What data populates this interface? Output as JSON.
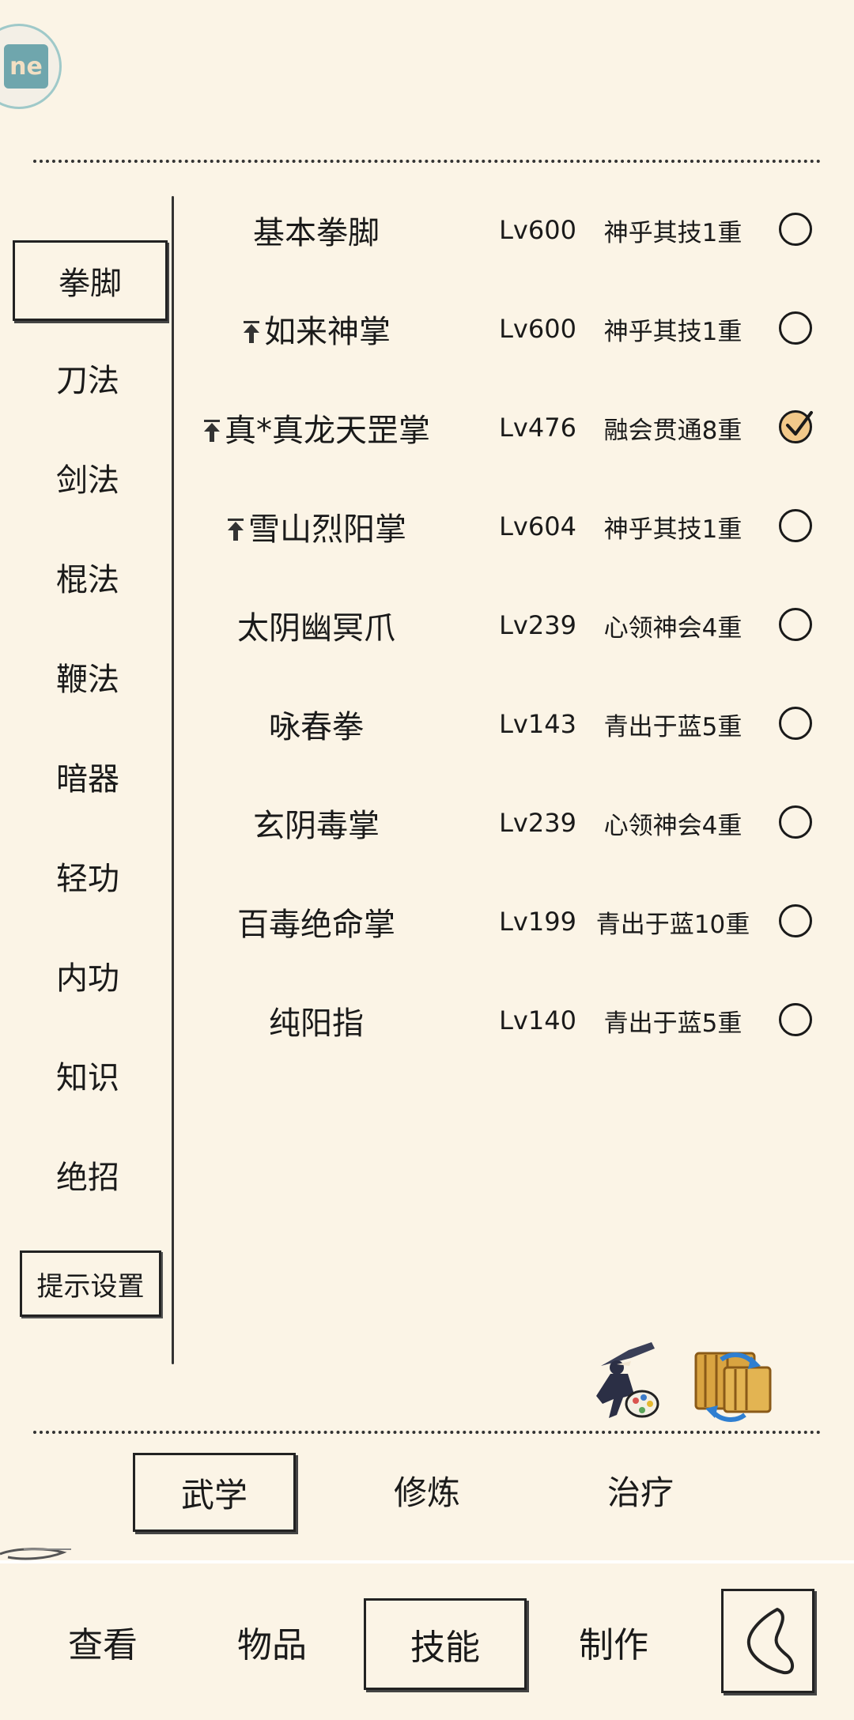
{
  "logo": {
    "text": "ne"
  },
  "categories": [
    {
      "label": "拳脚",
      "active": true
    },
    {
      "label": "刀法",
      "active": false
    },
    {
      "label": "剑法",
      "active": false
    },
    {
      "label": "棍法",
      "active": false
    },
    {
      "label": "鞭法",
      "active": false
    },
    {
      "label": "暗器",
      "active": false
    },
    {
      "label": "轻功",
      "active": false
    },
    {
      "label": "内功",
      "active": false
    },
    {
      "label": "知识",
      "active": false
    },
    {
      "label": "绝招",
      "active": false
    }
  ],
  "hint_settings": "提示设置",
  "skills": [
    {
      "name": "基本拳脚",
      "level": "Lv600",
      "rank": "神乎其技1重",
      "arrow": false,
      "checked": false
    },
    {
      "name": "如来神掌",
      "level": "Lv600",
      "rank": "神乎其技1重",
      "arrow": true,
      "checked": false
    },
    {
      "name": "真*真龙天罡掌",
      "level": "Lv476",
      "rank": "融会贯通8重",
      "arrow": true,
      "checked": true
    },
    {
      "name": "雪山烈阳掌",
      "level": "Lv604",
      "rank": "神乎其技1重",
      "arrow": true,
      "checked": false
    },
    {
      "name": "太阴幽冥爪",
      "level": "Lv239",
      "rank": "心领神会4重",
      "arrow": false,
      "checked": false
    },
    {
      "name": "咏春拳",
      "level": "Lv143",
      "rank": "青出于蓝5重",
      "arrow": false,
      "checked": false
    },
    {
      "name": "玄阴毒掌",
      "level": "Lv239",
      "rank": "心领神会4重",
      "arrow": false,
      "checked": false
    },
    {
      "name": "百毒绝命掌",
      "level": "Lv199",
      "rank": "青出于蓝10重",
      "arrow": false,
      "checked": false
    },
    {
      "name": "纯阳指",
      "level": "Lv140",
      "rank": "青出于蓝5重",
      "arrow": false,
      "checked": false
    }
  ],
  "sub_tabs": [
    {
      "label": "武学",
      "active": true
    },
    {
      "label": "修炼",
      "active": false
    },
    {
      "label": "治疗",
      "active": false
    }
  ],
  "nav_tabs": [
    {
      "label": "查看",
      "active": false
    },
    {
      "label": "物品",
      "active": false
    },
    {
      "label": "技能",
      "active": true
    },
    {
      "label": "制作",
      "active": false
    }
  ],
  "icons": {
    "logo": "app-logo-icon",
    "up_arrow": "up-arrow-icon",
    "radio": "radio-circle-icon",
    "ninja": "ninja-costume-icon",
    "scroll": "scroll-swap-icon",
    "back": "back-icon"
  },
  "colors": {
    "background": "#fbf4e6",
    "checked_fill": "#f2c98a",
    "ink": "#1a1a1a"
  }
}
